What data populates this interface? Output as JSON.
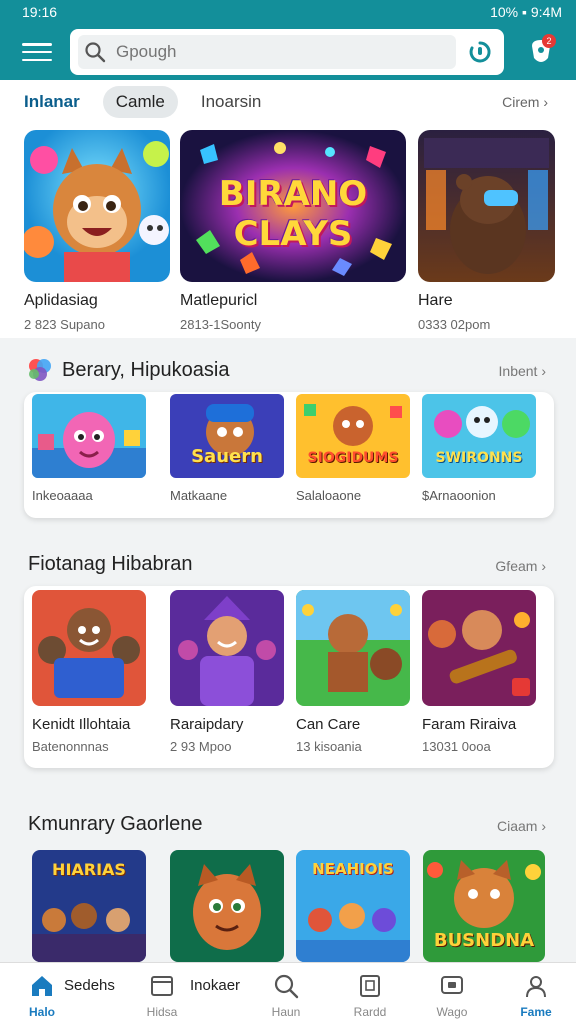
{
  "status": {
    "time": "19:16",
    "right": "10% ▪ 9:4M"
  },
  "search": {
    "placeholder": "Gpough",
    "badge": "2"
  },
  "tabs": {
    "items": [
      "Inlanar",
      "Camle",
      "Inoarsin"
    ],
    "more": "Cirem ›"
  },
  "featured": [
    {
      "title": "Aplidasiag",
      "sub": "2 823 Supano"
    },
    {
      "title": "Matlepuricl",
      "sub": "2813-1Soonty",
      "art_text": "BIRANO CLAYS"
    },
    {
      "title": "Hare",
      "sub": "0333 02pom"
    }
  ],
  "section2": {
    "title": "Berary, Hipukoasia",
    "more": "Inbent ›",
    "items": [
      {
        "caption": "Inkeoaaaa",
        "art_text": ""
      },
      {
        "caption": "Matkaane",
        "art_text": "Sauern"
      },
      {
        "caption": "Salaloaone",
        "art_text": "SIOGIDUMS"
      },
      {
        "caption": "$Arnaoonion",
        "art_text": "SWIRONNS"
      }
    ]
  },
  "section3": {
    "title": "Fiotanag Hibabran",
    "more": "Gfeam ›",
    "items": [
      {
        "title": "Kenidt Illohtaia",
        "sub": "Batenonnnas"
      },
      {
        "title": "Raraipdary",
        "sub": "2 93 Mpoo"
      },
      {
        "title": "Can Care",
        "sub": "13 kisoania"
      },
      {
        "title": "Faram Riraiva",
        "sub": "13031 0ooa"
      }
    ]
  },
  "section4": {
    "title": "Kmunrary Gaorlene",
    "more": "Ciaam ›",
    "items": [
      {
        "art_text": "HIARIAS"
      },
      {
        "art_text": ""
      },
      {
        "art_text": "NEAHIOIS"
      },
      {
        "art_text": "BUSNDNA"
      }
    ]
  },
  "bottomnav": {
    "side_labels": [
      "Sedehs",
      "Inokaer"
    ],
    "items": [
      {
        "label": "Halo",
        "icon": "home-icon"
      },
      {
        "label": "Hidsa",
        "icon": "window-icon"
      },
      {
        "label": "Haun",
        "icon": "search-icon"
      },
      {
        "label": "Rardd",
        "icon": "gamepad-icon"
      },
      {
        "label": "Wago",
        "icon": "monitor-icon"
      },
      {
        "label": "Fame",
        "icon": "person-icon"
      }
    ]
  },
  "colors": {
    "accent": "#138f9a",
    "active_nav": "#1a7bbf"
  }
}
